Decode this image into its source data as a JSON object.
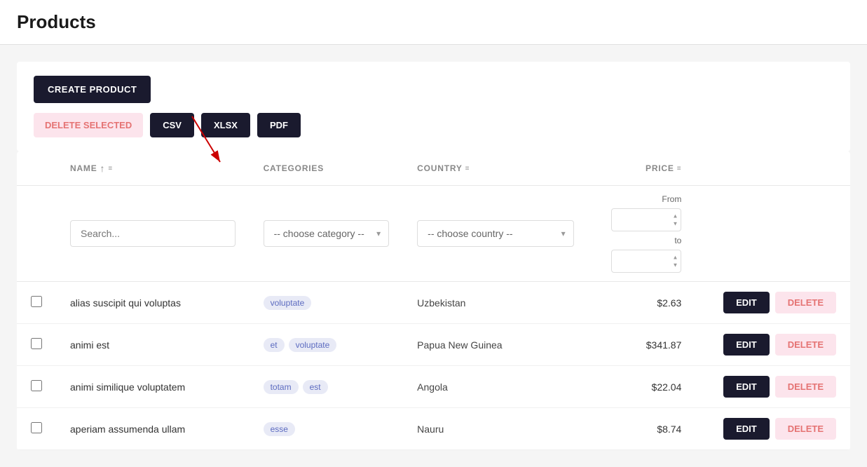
{
  "page": {
    "title": "Products"
  },
  "toolbar": {
    "create_label": "CREATE PRODUCT",
    "delete_selected_label": "DELETE SELECTED",
    "csv_label": "CSV",
    "xlsx_label": "XLSX",
    "pdf_label": "PDF"
  },
  "filters": {
    "search_placeholder": "Search...",
    "category_placeholder": "-- choose category --",
    "country_placeholder": "-- choose country --",
    "price_from_label": "From",
    "price_to_label": "to"
  },
  "table": {
    "columns": [
      {
        "key": "checkbox",
        "label": ""
      },
      {
        "key": "name",
        "label": "NAME"
      },
      {
        "key": "categories",
        "label": "CATEGORIES"
      },
      {
        "key": "country",
        "label": "COUNTRY"
      },
      {
        "key": "price",
        "label": "PRICE"
      },
      {
        "key": "actions",
        "label": ""
      }
    ],
    "rows": [
      {
        "id": 1,
        "name": "alias suscipit qui voluptas",
        "categories": [
          "voluptate"
        ],
        "country": "Uzbekistan",
        "price": "$2.63"
      },
      {
        "id": 2,
        "name": "animi est",
        "categories": [
          "et",
          "voluptate"
        ],
        "country": "Papua New Guinea",
        "price": "$341.87"
      },
      {
        "id": 3,
        "name": "animi similique voluptatem",
        "categories": [
          "totam",
          "est"
        ],
        "country": "Angola",
        "price": "$22.04"
      },
      {
        "id": 4,
        "name": "aperiam assumenda ullam",
        "categories": [
          "esse"
        ],
        "country": "Nauru",
        "price": "$8.74"
      }
    ]
  },
  "buttons": {
    "edit_label": "EDIT",
    "delete_label": "DELETE"
  }
}
